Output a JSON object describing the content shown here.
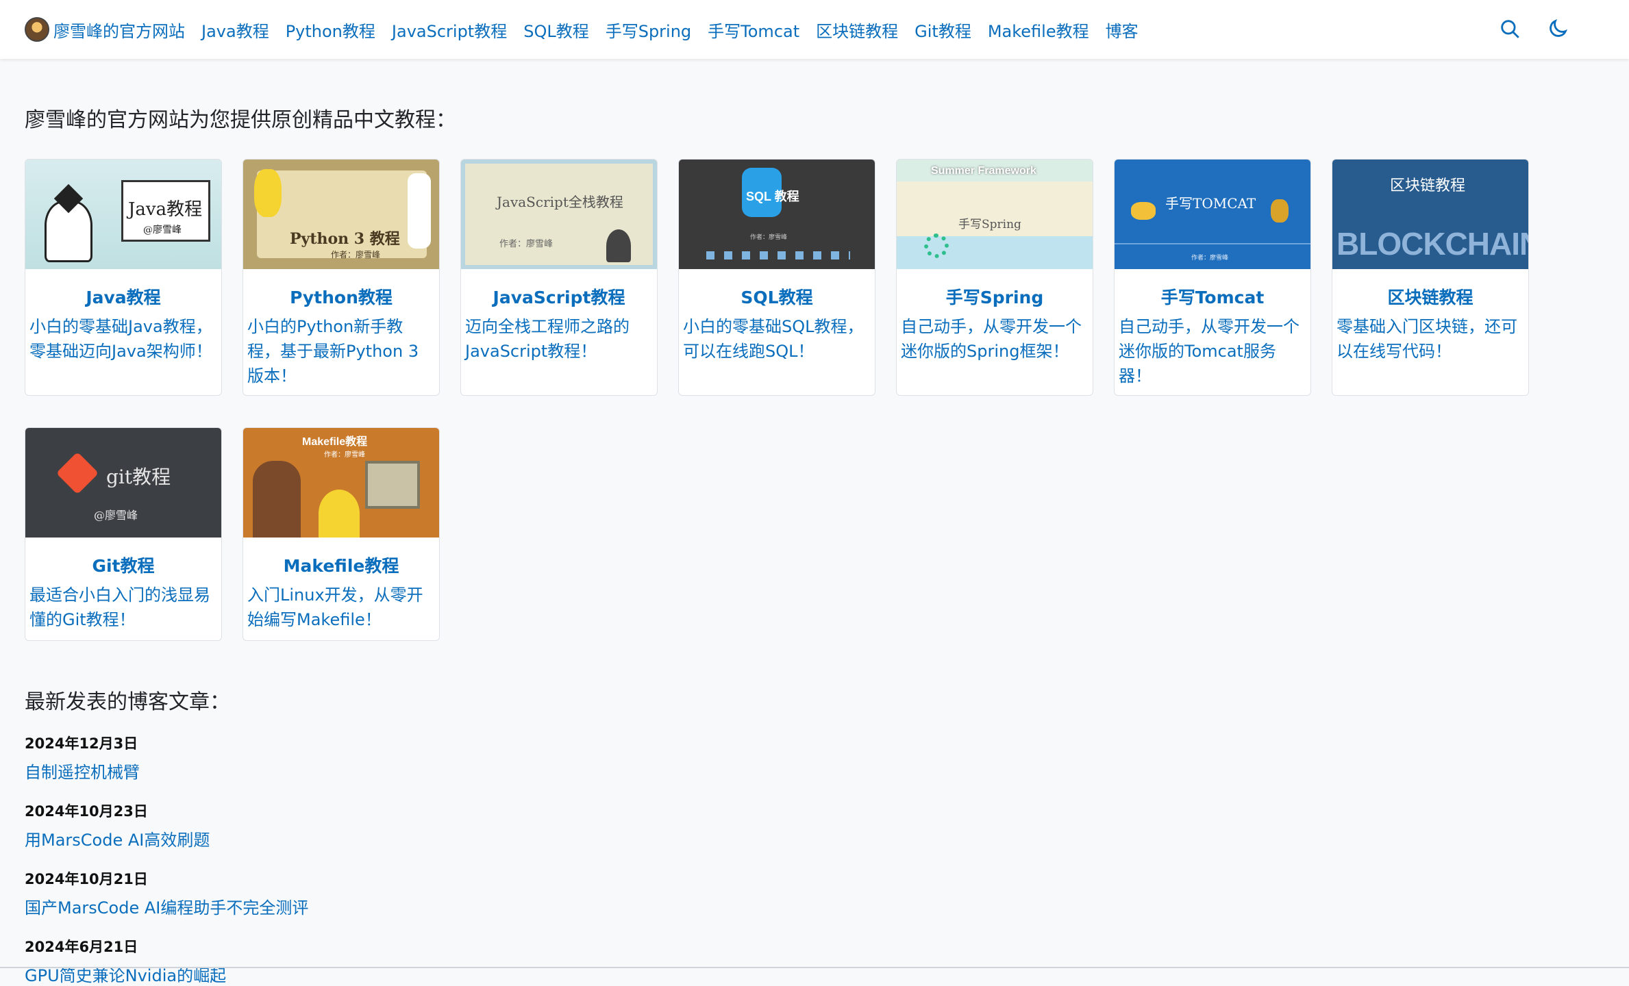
{
  "nav": {
    "brand": "廖雪峰的官方网站",
    "links": [
      "Java教程",
      "Python教程",
      "JavaScript教程",
      "SQL教程",
      "手写Spring",
      "手写Tomcat",
      "区块链教程",
      "Git教程",
      "Makefile教程",
      "博客"
    ]
  },
  "icons": {
    "search": "search-icon",
    "theme": "moon-icon"
  },
  "intro": "廖雪峰的官方网站为您提供原创精品中文教程：",
  "courses": [
    {
      "title": "Java教程",
      "desc": "小白的零基础Java教程，零基础迈向Java架构师！",
      "cover_text": "Java教程",
      "cover_sub": "@廖雪峰"
    },
    {
      "title": "Python教程",
      "desc": "小白的Python新手教程，基于最新Python 3版本！",
      "cover_text": "Python 3 教程",
      "cover_sub": "作者：廖雪峰"
    },
    {
      "title": "JavaScript教程",
      "desc": "迈向全栈工程师之路的JavaScript教程！",
      "cover_text": "JavaScript全栈教程",
      "cover_sub": "作者：廖雪峰"
    },
    {
      "title": "SQL教程",
      "desc": "小白的零基础SQL教程，可以在线跑SQL！",
      "cover_text": "SQL 教程",
      "cover_sub": "作者：廖雪峰"
    },
    {
      "title": "手写Spring",
      "desc": "自己动手，从零开发一个迷你版的Spring框架！",
      "cover_text": "Summer Framework",
      "cover_sub": "手写Spring"
    },
    {
      "title": "手写Tomcat",
      "desc": "自己动手，从零开发一个迷你版的Tomcat服务器！",
      "cover_text": "手写TOMCAT",
      "cover_sub": "作者：廖雪峰"
    },
    {
      "title": "区块链教程",
      "desc": "零基础入门区块链，还可以在线写代码！",
      "cover_text": "区块链教程",
      "cover_sub": "BLOCKCHAIN"
    },
    {
      "title": "Git教程",
      "desc": "最适合小白入门的浅显易懂的Git教程！",
      "cover_text": "git教程",
      "cover_sub": "@廖雪峰"
    },
    {
      "title": "Makefile教程",
      "desc": "入门Linux开发，从零开始编写Makefile！",
      "cover_text": "Makefile教程",
      "cover_sub": "作者：廖雪峰"
    }
  ],
  "blog": {
    "heading": "最新发表的博客文章：",
    "posts": [
      {
        "date": "2024年12月3日",
        "title": "自制遥控机械臂"
      },
      {
        "date": "2024年10月23日",
        "title": "用MarsCode AI高效刷题"
      },
      {
        "date": "2024年10月21日",
        "title": "国产MarsCode AI编程助手不完全测评"
      },
      {
        "date": "2024年6月21日",
        "title": "GPU简史兼论Nvidia的崛起"
      }
    ]
  }
}
